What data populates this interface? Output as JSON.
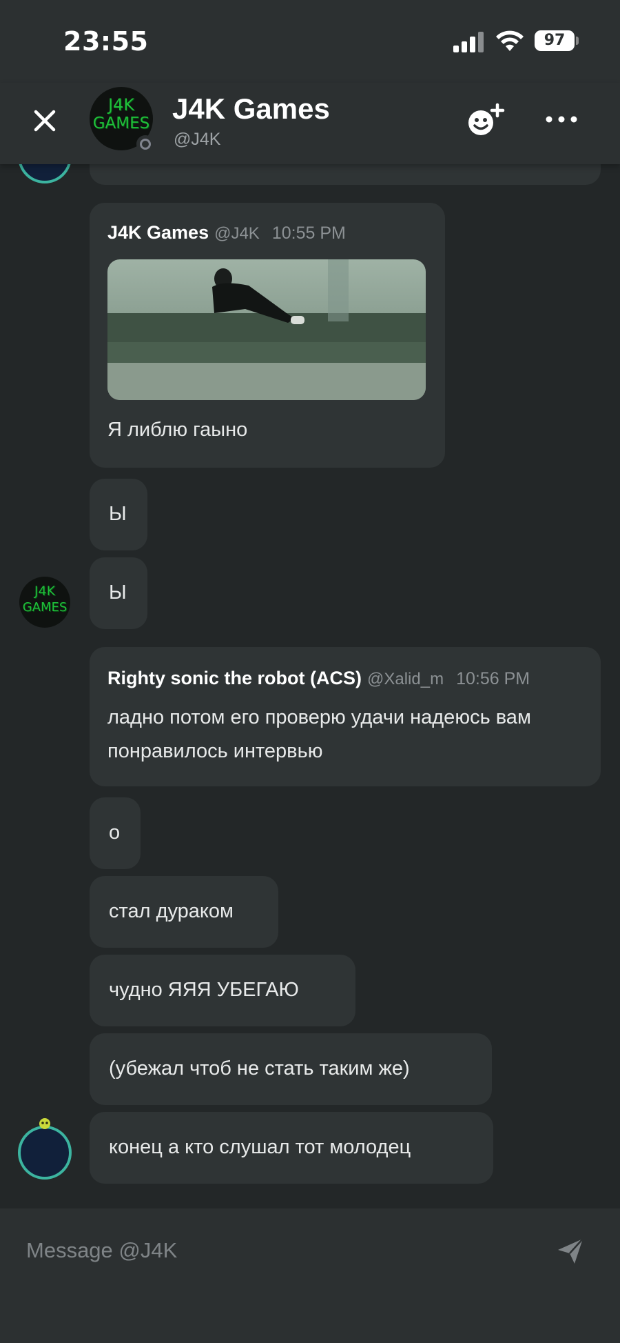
{
  "status_bar": {
    "time": "23:55",
    "battery": "97"
  },
  "header": {
    "title": "J4K Games",
    "handle": "@J4K",
    "avatar_text_line1": "J4K",
    "avatar_text_line2": "GAMES",
    "icons": {
      "close": "close-icon",
      "add_friend": "add-friend-icon",
      "more": "more-icon"
    }
  },
  "messages": [
    {
      "author": "J4K Games",
      "handle": "@J4K",
      "time": "10:55 PM",
      "has_image": true,
      "text": "Я либлю гаыно"
    },
    {
      "text": "Ы"
    },
    {
      "text": "Ы"
    },
    {
      "author": "Righty sonic the robot (ACS)",
      "handle": "@Xalid_m",
      "time": "10:56 PM",
      "text": "ладно потом его проверю удачи надеюсь вам понравилось интервью"
    },
    {
      "text": "о"
    },
    {
      "text": "стал дураком"
    },
    {
      "text": "чудно ЯЯЯ УБЕГАЮ"
    },
    {
      "text": "(убежал чтоб не стать таким же)"
    },
    {
      "text": "конец а кто слушал тот молодец"
    }
  ],
  "avatars": {
    "j4k_line1": "J4K",
    "j4k_line2": "GAMES"
  },
  "composer": {
    "placeholder": "Message @J4K",
    "send_icon": "send-icon"
  },
  "colors": {
    "background": "#232728",
    "bubble": "#2f3435",
    "header": "#2c3031",
    "avatar_green": "#1fbf3a",
    "ring_teal": "#3cb4a0"
  }
}
